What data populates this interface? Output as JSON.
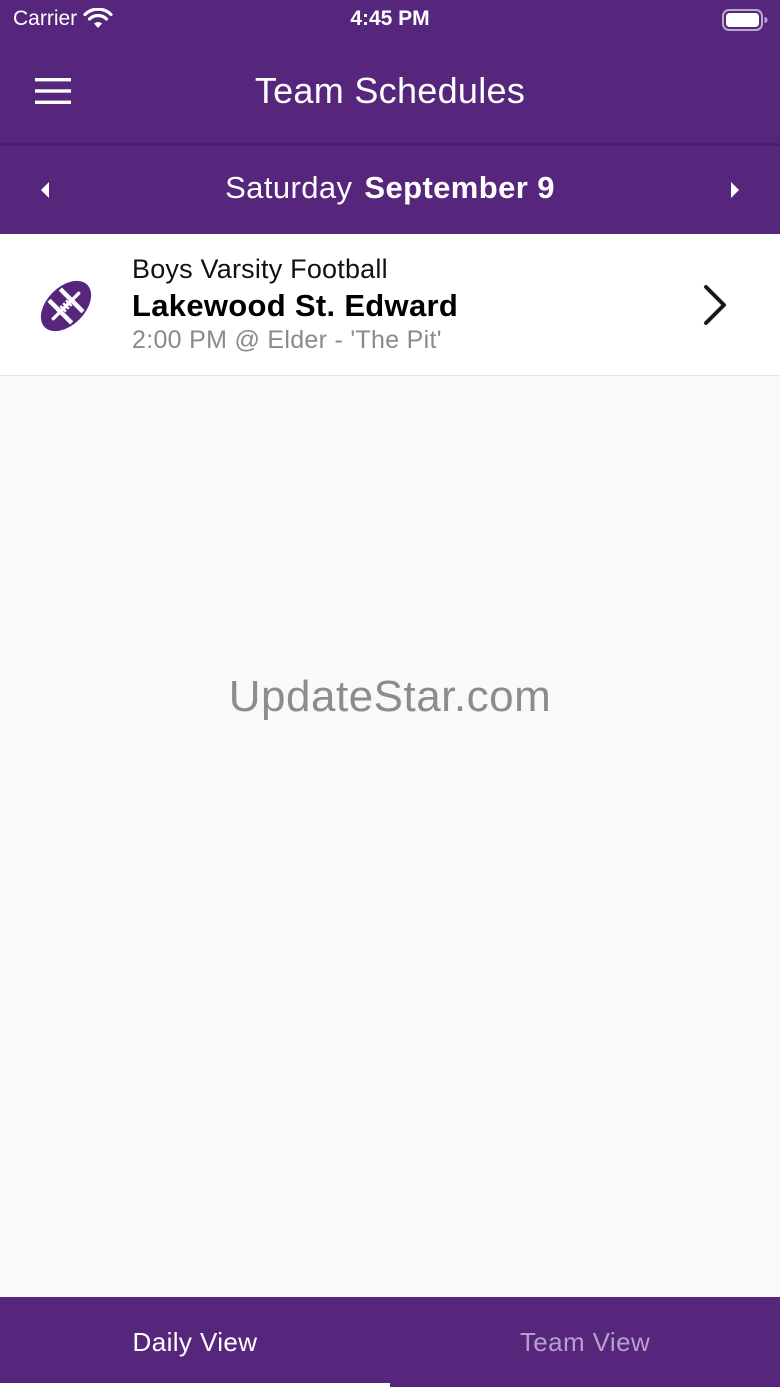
{
  "status_bar": {
    "carrier": "Carrier",
    "time": "4:45 PM",
    "icons": [
      "wifi-icon",
      "battery-icon"
    ]
  },
  "header": {
    "title": "Team Schedules",
    "menu_icon": "hamburger-menu-icon"
  },
  "date_nav": {
    "weekday": "Saturday",
    "date": "September 9",
    "prev_icon": "caret-left-icon",
    "next_icon": "caret-right-icon"
  },
  "events": [
    {
      "sport": "Boys Varsity Football",
      "opponent": "Lakewood St. Edward",
      "details": "2:00 PM @ Elder - 'The Pit'",
      "icon": "football-icon"
    }
  ],
  "watermark": "UpdateStar.com",
  "tabs": [
    {
      "label": "Daily View",
      "active": true
    },
    {
      "label": "Team View",
      "active": false
    }
  ],
  "colors": {
    "brand": "#56267d",
    "background": "#f9f9f9",
    "inactive_tab_text": "#b79fcc"
  }
}
